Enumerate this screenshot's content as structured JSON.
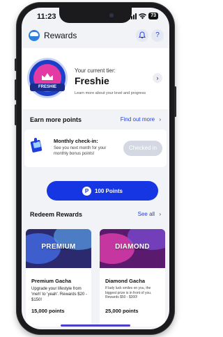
{
  "status": {
    "time": "11:23",
    "battery": "73"
  },
  "header": {
    "title": "Rewards",
    "bell_icon": "bell-icon",
    "help_label": "?"
  },
  "tier": {
    "caption": "Your current tier:",
    "name": "Freshie",
    "badge_label": "FRESHIE",
    "learn_more": "Learn more about your level and progress",
    "arrow": "›"
  },
  "earn": {
    "title": "Earn more points",
    "link": "Find out more",
    "link_arrow": "›",
    "checkin": {
      "title": "Monthly check-in:",
      "description": "See you next month for your monthly bonus points!",
      "button": "Checked in"
    }
  },
  "points_button": {
    "icon": "P",
    "label": "100 Points"
  },
  "redeem": {
    "title": "Redeem Rewards",
    "link": "See all",
    "link_arrow": "›",
    "cards": [
      {
        "art_label": "PREMIUM",
        "name": "Premium Gacha",
        "description": "Upgrade your lifestyle from 'meh' to 'yeah'. Rewards $20 - $150!",
        "points": "15,000 points"
      },
      {
        "art_label": "DIAMOND",
        "name": "Diamond Gacha",
        "description": "If lady luck smiles on you, the biggest prize is in front of you. Rewards $50 - $300!",
        "points": "25,000 points"
      }
    ]
  },
  "colors": {
    "accent": "#1635e3",
    "background": "#f2f3f7",
    "disabled": "#d4d8e2"
  }
}
